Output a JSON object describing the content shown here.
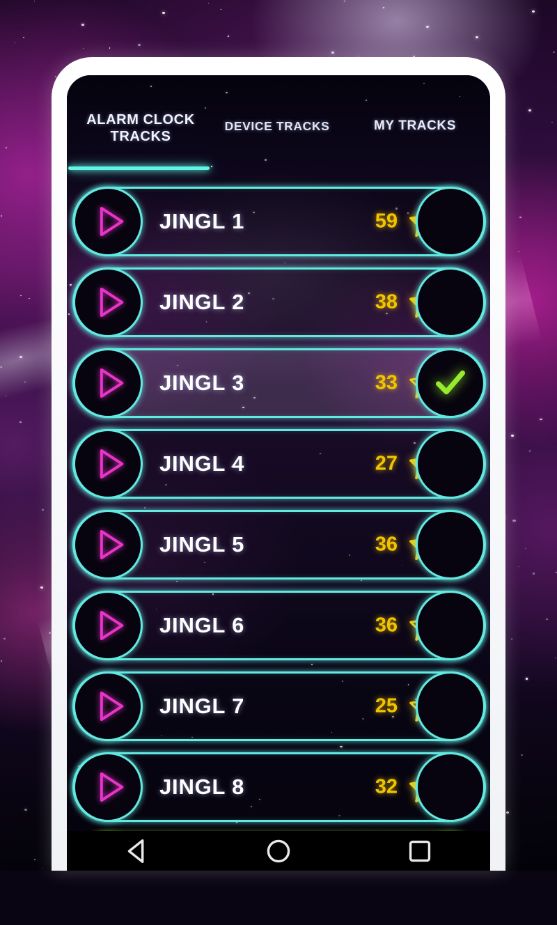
{
  "app": {
    "tabs": [
      {
        "label": "ALARM CLOCK TRACKS",
        "active": true
      },
      {
        "label": "DEVICE TRACKS",
        "active": false
      },
      {
        "label": "MY TRACKS",
        "active": false
      }
    ],
    "tracks": [
      {
        "name": "JINGL 1",
        "count": "59",
        "starred": true,
        "selected": false
      },
      {
        "name": "JINGL 2",
        "count": "38",
        "starred": true,
        "selected": false
      },
      {
        "name": "JINGL 3",
        "count": "33",
        "starred": false,
        "selected": true
      },
      {
        "name": "JINGL 4",
        "count": "27",
        "starred": true,
        "selected": false
      },
      {
        "name": "JINGL 5",
        "count": "36",
        "starred": true,
        "selected": false
      },
      {
        "name": "JINGL 6",
        "count": "36",
        "starred": false,
        "selected": false
      },
      {
        "name": "JINGL 7",
        "count": "25",
        "starred": false,
        "selected": false
      },
      {
        "name": "JINGL 8",
        "count": "32",
        "starred": true,
        "selected": false
      }
    ],
    "icons": {
      "play": "play-icon",
      "star_filled": "star-filled-icon",
      "star_outline": "star-outline-icon",
      "check": "check-icon"
    },
    "colors": {
      "neon_cyan": "#62e9e0",
      "neon_magenta": "#e834c8",
      "neon_green": "#95e828",
      "gold": "#f2c400",
      "text_white": "#ffffff"
    }
  },
  "navbar": {
    "back": "back-button",
    "home": "home-button",
    "recents": "recents-button"
  }
}
